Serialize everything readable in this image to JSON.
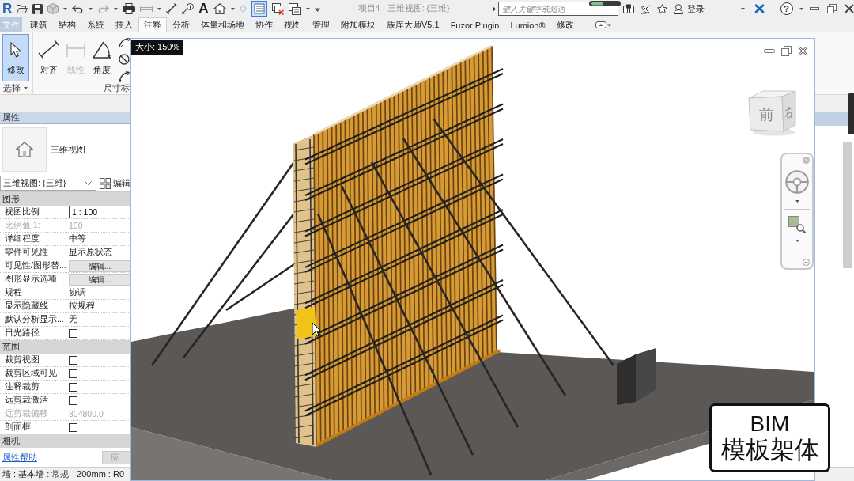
{
  "app_toolbar": {
    "logo": "R",
    "text_tool": "A",
    "title": "项目4 - 三维视图: {三维}"
  },
  "info_center": {
    "search": {
      "placeholder": "键入关键字或短语"
    },
    "sign_in": "登录",
    "help": "?"
  },
  "ribbon_tabs": [
    {
      "label": "文件",
      "kind": "file",
      "selected": false
    },
    {
      "label": "建筑",
      "kind": "tab",
      "selected": false
    },
    {
      "label": "结构",
      "kind": "tab",
      "selected": false
    },
    {
      "label": "系统",
      "kind": "tab",
      "selected": false
    },
    {
      "label": "插入",
      "kind": "tab",
      "selected": false
    },
    {
      "label": "注释",
      "kind": "tab",
      "selected": true
    },
    {
      "label": "分析",
      "kind": "tab",
      "selected": false
    },
    {
      "label": "体量和场地",
      "kind": "tab",
      "selected": false
    },
    {
      "label": "协作",
      "kind": "tab",
      "selected": false
    },
    {
      "label": "视图",
      "kind": "tab",
      "selected": false
    },
    {
      "label": "管理",
      "kind": "tab",
      "selected": false
    },
    {
      "label": "附加模块",
      "kind": "tab",
      "selected": false
    },
    {
      "label": "族库大师V5.1",
      "kind": "tab",
      "selected": false
    },
    {
      "label": "Fuzor Plugin",
      "kind": "tab",
      "selected": false
    },
    {
      "label": "Lumion®",
      "kind": "tab",
      "selected": false
    },
    {
      "label": "修改",
      "kind": "tab",
      "selected": false
    }
  ],
  "ribbon_panels": [
    {
      "title": "选择",
      "tools": [
        {
          "label": "修改",
          "selected": true,
          "disabled": false
        }
      ]
    },
    {
      "title": "尺寸标",
      "tools": [
        {
          "label": "对齐",
          "selected": false,
          "disabled": false
        },
        {
          "label": "线性",
          "selected": false,
          "disabled": true
        },
        {
          "label": "角度",
          "selected": false,
          "disabled": false
        }
      ]
    }
  ],
  "properties": {
    "title": "属性",
    "type_name": "三维视图",
    "type_selector": "三维视图: {三维}",
    "edit_type": "编辑",
    "groups": [
      {
        "name": "图形",
        "rows": [
          {
            "label": "视图比例",
            "kind": "input",
            "value": "1 : 100",
            "disabled": false
          },
          {
            "label": "比例值 1:",
            "kind": "text",
            "value": "100",
            "disabled": true
          },
          {
            "label": "详细程度",
            "kind": "text",
            "value": "中等",
            "disabled": false
          },
          {
            "label": "零件可见性",
            "kind": "text",
            "value": "显示原状态",
            "disabled": false
          },
          {
            "label": "可见性/图形替...",
            "kind": "button",
            "value": "编辑...",
            "disabled": false
          },
          {
            "label": "图形显示选项",
            "kind": "button",
            "value": "编辑...",
            "disabled": false
          },
          {
            "label": "规程",
            "kind": "text",
            "value": "协调",
            "disabled": false
          },
          {
            "label": "显示隐藏线",
            "kind": "text",
            "value": "按规程",
            "disabled": false
          },
          {
            "label": "默认分析显示...",
            "kind": "text",
            "value": "无",
            "disabled": false
          },
          {
            "label": "日光路径",
            "kind": "checkbox",
            "checked": false,
            "disabled": false
          }
        ]
      },
      {
        "name": "范围",
        "rows": [
          {
            "label": "裁剪视图",
            "kind": "checkbox",
            "checked": false,
            "disabled": false
          },
          {
            "label": "裁剪区域可见",
            "kind": "checkbox",
            "checked": false,
            "disabled": false
          },
          {
            "label": "注释裁剪",
            "kind": "checkbox",
            "checked": false,
            "disabled": false
          },
          {
            "label": "远剪裁激活",
            "kind": "checkbox",
            "checked": false,
            "disabled": false
          },
          {
            "label": "远剪裁偏移",
            "kind": "text",
            "value": "304800.0",
            "disabled": true
          },
          {
            "label": "剖面框",
            "kind": "checkbox",
            "checked": false,
            "disabled": false
          }
        ]
      },
      {
        "name": "相机"
      }
    ],
    "help_link": "属性帮助",
    "apply_button": {
      "label": "应",
      "disabled": true
    }
  },
  "view": {
    "zoom_tooltip": "大小: 150%",
    "view_cube": {
      "front": "前",
      "right": "右"
    }
  },
  "caption": {
    "title": "BIM",
    "subtitle": "模板架体"
  },
  "status_bar": "墙 : 基本墙 : 常规 - 200mm : R0"
}
